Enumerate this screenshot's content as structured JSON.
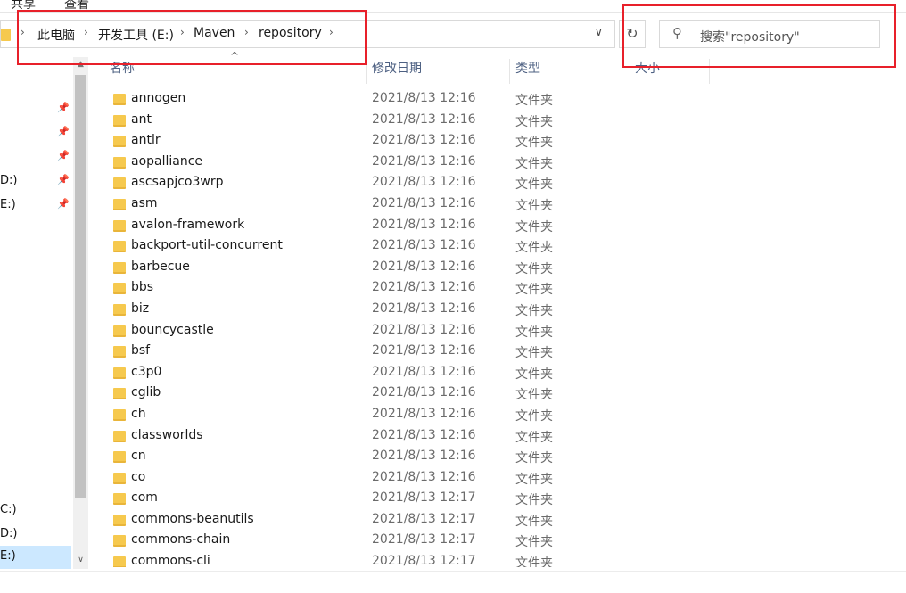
{
  "ribbon": {
    "tabs": [
      "共享",
      "查看"
    ]
  },
  "address_bar": {
    "crumbs": [
      "此电脑",
      "开发工具 (E:)",
      "Maven",
      "repository"
    ]
  },
  "search": {
    "placeholder": "搜索\"repository\""
  },
  "nav": {
    "items": [
      "D:)",
      "E:)",
      "C:)",
      "D:)",
      "E:)"
    ]
  },
  "columns": {
    "name": "名称",
    "date": "修改日期",
    "type": "类型",
    "size": "大小"
  },
  "files": [
    {
      "name": "annogen",
      "date": "2021/8/13 12:16",
      "type": "文件夹"
    },
    {
      "name": "ant",
      "date": "2021/8/13 12:16",
      "type": "文件夹"
    },
    {
      "name": "antlr",
      "date": "2021/8/13 12:16",
      "type": "文件夹"
    },
    {
      "name": "aopalliance",
      "date": "2021/8/13 12:16",
      "type": "文件夹"
    },
    {
      "name": "ascsapjco3wrp",
      "date": "2021/8/13 12:16",
      "type": "文件夹"
    },
    {
      "name": "asm",
      "date": "2021/8/13 12:16",
      "type": "文件夹"
    },
    {
      "name": "avalon-framework",
      "date": "2021/8/13 12:16",
      "type": "文件夹"
    },
    {
      "name": "backport-util-concurrent",
      "date": "2021/8/13 12:16",
      "type": "文件夹"
    },
    {
      "name": "barbecue",
      "date": "2021/8/13 12:16",
      "type": "文件夹"
    },
    {
      "name": "bbs",
      "date": "2021/8/13 12:16",
      "type": "文件夹"
    },
    {
      "name": "biz",
      "date": "2021/8/13 12:16",
      "type": "文件夹"
    },
    {
      "name": "bouncycastle",
      "date": "2021/8/13 12:16",
      "type": "文件夹"
    },
    {
      "name": "bsf",
      "date": "2021/8/13 12:16",
      "type": "文件夹"
    },
    {
      "name": "c3p0",
      "date": "2021/8/13 12:16",
      "type": "文件夹"
    },
    {
      "name": "cglib",
      "date": "2021/8/13 12:16",
      "type": "文件夹"
    },
    {
      "name": "ch",
      "date": "2021/8/13 12:16",
      "type": "文件夹"
    },
    {
      "name": "classworlds",
      "date": "2021/8/13 12:16",
      "type": "文件夹"
    },
    {
      "name": "cn",
      "date": "2021/8/13 12:16",
      "type": "文件夹"
    },
    {
      "name": "co",
      "date": "2021/8/13 12:16",
      "type": "文件夹"
    },
    {
      "name": "com",
      "date": "2021/8/13 12:17",
      "type": "文件夹"
    },
    {
      "name": "commons-beanutils",
      "date": "2021/8/13 12:17",
      "type": "文件夹"
    },
    {
      "name": "commons-chain",
      "date": "2021/8/13 12:17",
      "type": "文件夹"
    },
    {
      "name": "commons-cli",
      "date": "2021/8/13 12:17",
      "type": "文件夹"
    }
  ],
  "colors": {
    "highlight": "#e8202a",
    "folder": "#f6c94e",
    "selected": "#cce8ff"
  }
}
